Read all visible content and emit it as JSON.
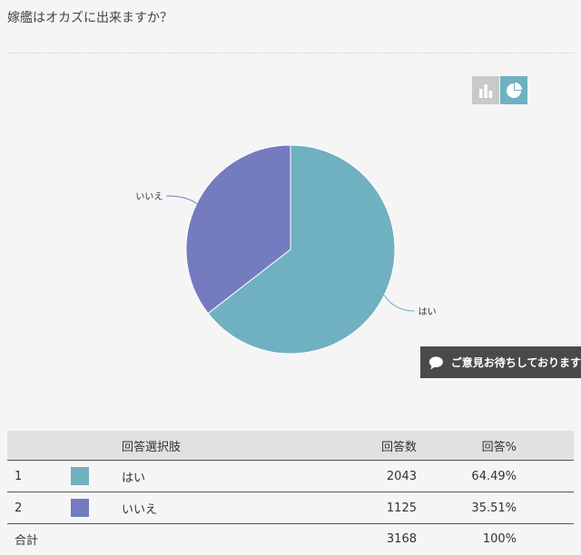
{
  "question": "嫁艦はオカズに出来ますか？",
  "toggles": {
    "bar_icon": "bar-chart-icon",
    "pie_icon": "pie-chart-icon"
  },
  "feedback": {
    "label": "ご意見お待ちしております",
    "icon": "speech-bubble-icon"
  },
  "colors": {
    "yes": "#6fb1c0",
    "no": "#757bbf"
  },
  "chart_data": {
    "type": "pie",
    "categories": [
      "はい",
      "いいえ"
    ],
    "values": [
      2043,
      1125
    ],
    "percentages": [
      64.49,
      35.51
    ],
    "colors": [
      "#6fb1c0",
      "#757bbf"
    ]
  },
  "table": {
    "headers": {
      "choice": "回答選択肢",
      "count": "回答数",
      "percent": "回答%"
    },
    "rows": [
      {
        "no": "1",
        "label": "はい",
        "count": "2043",
        "percent": "64.49%"
      },
      {
        "no": "2",
        "label": "いいえ",
        "count": "1125",
        "percent": "35.51%"
      }
    ],
    "total": {
      "label": "合計",
      "count": "3168",
      "percent": "100%"
    }
  }
}
